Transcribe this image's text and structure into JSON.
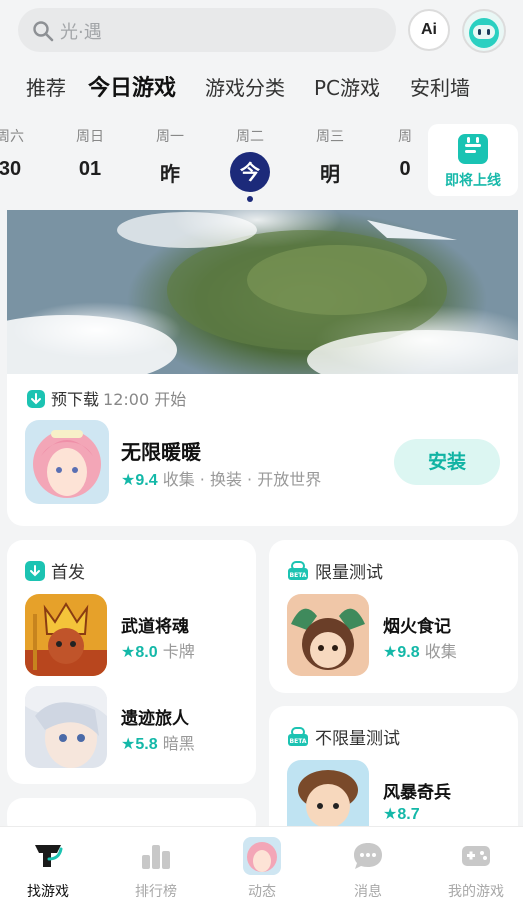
{
  "search": {
    "placeholder": "光·遇"
  },
  "header": {
    "ai_label": "Ai"
  },
  "tabs": [
    {
      "label": "推荐"
    },
    {
      "label": "今日游戏",
      "active": true
    },
    {
      "label": "游戏分类"
    },
    {
      "label": "PC游戏"
    },
    {
      "label": "安利墙"
    }
  ],
  "dates": [
    {
      "weekday": "周六",
      "day": "30"
    },
    {
      "weekday": "周日",
      "day": "01"
    },
    {
      "weekday": "周一",
      "day": "昨"
    },
    {
      "weekday": "周二",
      "day": "今",
      "selected": true
    },
    {
      "weekday": "周三",
      "day": "明"
    },
    {
      "weekday": "周",
      "day": "0"
    }
  ],
  "upcoming": {
    "label": "即将上线"
  },
  "featured": {
    "status": "预下载",
    "time": "12:00 开始",
    "name": "无限暖暖",
    "score": "9.4",
    "tags": "收集 · 换装 · 开放世界",
    "button": "安装"
  },
  "first_release": {
    "title": "首发",
    "games": [
      {
        "name": "武道将魂",
        "score": "8.0",
        "tag": "卡牌"
      },
      {
        "name": "遗迹旅人",
        "score": "5.8",
        "tag": "暗黑"
      }
    ]
  },
  "limited_test": {
    "title": "限量测试",
    "games": [
      {
        "name": "烟火食记",
        "score": "9.8",
        "tag": "收集"
      }
    ]
  },
  "unlimited_test": {
    "title": "不限量测试",
    "games": [
      {
        "name": "风暴奇兵",
        "score": "8.7",
        "tag": ""
      }
    ]
  },
  "nav": [
    {
      "label": "找游戏",
      "icon": "find-game-icon",
      "active": true
    },
    {
      "label": "排行榜",
      "icon": "ranking-icon"
    },
    {
      "label": "动态",
      "icon": "feed-avatar-icon"
    },
    {
      "label": "消息",
      "icon": "message-icon"
    },
    {
      "label": "我的游戏",
      "icon": "gamepad-icon"
    }
  ],
  "colors": {
    "accent": "#1cc3b2",
    "selected_day": "#1c2a7a"
  }
}
